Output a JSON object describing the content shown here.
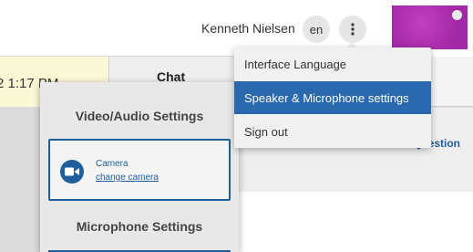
{
  "header": {
    "username": "Kenneth Nielsen",
    "language_code": "en"
  },
  "timebar": {
    "time_text": "2 1:17 PM"
  },
  "tabs": {
    "chat_label": "Chat"
  },
  "content": {
    "question_link": "Question"
  },
  "settings_panel": {
    "video_audio_heading": "Video/Audio Settings",
    "camera_title": "Camera",
    "camera_link": "change camera",
    "microphone_heading": "Microphone Settings"
  },
  "dropdown": {
    "items": [
      {
        "label": "Interface Language"
      },
      {
        "label": "Speaker & Microphone settings"
      },
      {
        "label": "Sign out"
      }
    ],
    "active_index": 1
  },
  "colors": {
    "accent": "#2a69ad",
    "link": "#1f5f9e",
    "time_bg": "#fbf8d6",
    "video": "#b535b4"
  },
  "icons": {
    "more": "vertical-dots-icon",
    "camera": "video-camera-icon"
  }
}
